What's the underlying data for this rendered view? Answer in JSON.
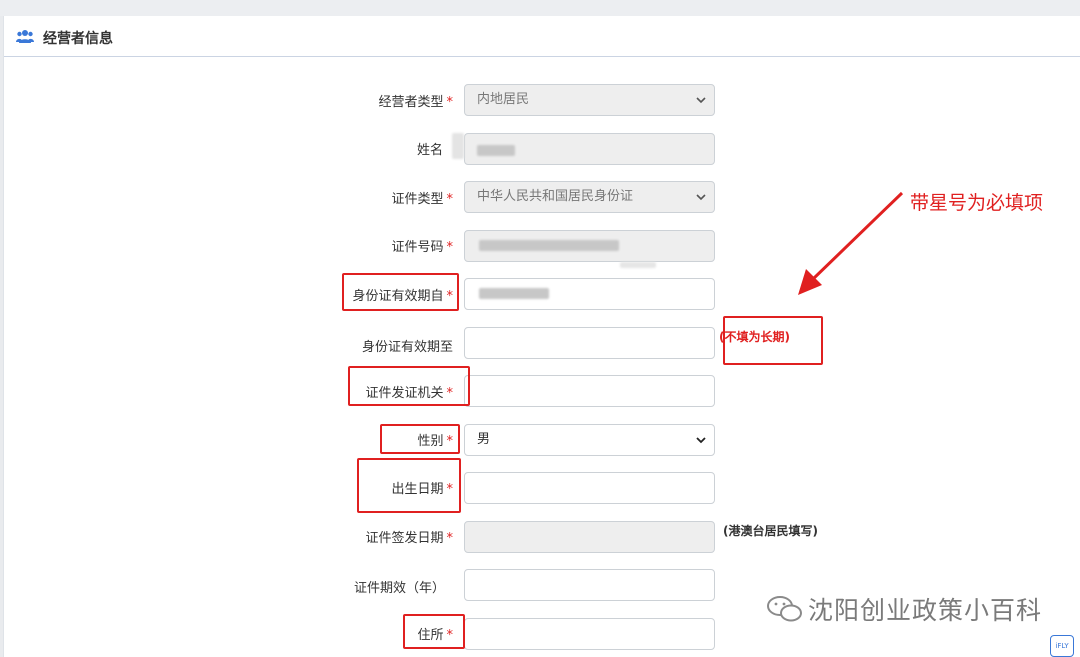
{
  "panel": {
    "title": "经营者信息",
    "icon": "users-icon"
  },
  "form": {
    "required_mark": "*",
    "operator_type": {
      "label": "经营者类型",
      "value": "内地居民"
    },
    "name": {
      "label": "姓名"
    },
    "id_type": {
      "label": "证件类型",
      "value": "中华人民共和国居民身份证"
    },
    "id_number": {
      "label": "证件号码"
    },
    "valid_from": {
      "label": "身份证有效期自"
    },
    "valid_to": {
      "label": "身份证有效期至",
      "note": "(不填为长期)"
    },
    "issuing_authority": {
      "label": "证件发证机关"
    },
    "gender": {
      "label": "性别",
      "value": "男"
    },
    "birth_date": {
      "label": "出生日期"
    },
    "issue_date": {
      "label": "证件签发日期",
      "note": "(港澳台居民填写)"
    },
    "validity_years": {
      "label": "证件期效（年）"
    },
    "residence": {
      "label": "住所"
    }
  },
  "annotation": {
    "text": "带星号为必填项",
    "color": "#e02020"
  },
  "watermark": {
    "text": "沈阳创业政策小百科"
  },
  "corner_button": {
    "label": "iFLY"
  }
}
